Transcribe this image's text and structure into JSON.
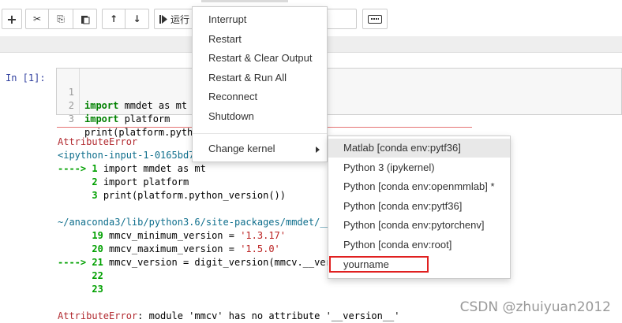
{
  "toolbar": {
    "buttons": [
      {
        "name": "add-cell",
        "glyph": "+"
      },
      {
        "name": "cut",
        "glyph": "✂"
      },
      {
        "name": "copy",
        "glyph": "⎘"
      },
      {
        "name": "paste",
        "glyph": "📋"
      },
      {
        "name": "move-up",
        "glyph": "↑"
      },
      {
        "name": "move-down",
        "glyph": "↓"
      }
    ],
    "run_label": "运行",
    "run_icon": "step-forward-icon",
    "keyboard_icon": "keyboard-icon"
  },
  "cell": {
    "prompt": "In  [1]:",
    "lines": [
      {
        "num": "1",
        "kw": "import",
        "rest": " mmdet as mt"
      },
      {
        "num": "2",
        "kw": "import",
        "rest": " platform"
      },
      {
        "num": "3",
        "kw": "",
        "rest": "print(platform.pytho"
      }
    ]
  },
  "output": {
    "error_name": "AttributeError",
    "input_ref": "<ipython-input-1-0165bd7",
    "trace1": [
      {
        "arrow": "---->",
        "num": "1",
        "code": " import mmdet as mt"
      },
      {
        "arrow": "     ",
        "num": "2",
        "code": " import platform"
      },
      {
        "arrow": "     ",
        "num": "3",
        "code": " print(platform.python_version())"
      }
    ],
    "path": "~/anaconda3/lib/python3.6/site-packages/mmdet/__i",
    "trace2": [
      {
        "arrow": "     ",
        "num": "19",
        "code": " mmcv_minimum_version = ",
        "str": "'1.3.17'"
      },
      {
        "arrow": "     ",
        "num": "20",
        "code": " mmcv_maximum_version = ",
        "str": "'1.5.0'"
      },
      {
        "arrow": "---->",
        "num": "21",
        "code": " mmcv_version = digit_version(mmcv.__versi",
        "str": ""
      },
      {
        "arrow": "     ",
        "num": "22",
        "code": "",
        "str": ""
      },
      {
        "arrow": "     ",
        "num": "23",
        "code": "",
        "str": ""
      }
    ],
    "final_error": "AttributeError",
    "final_msg": ": module 'mmcv' has no attribute '__version__'"
  },
  "kernel_menu": {
    "items": [
      "Interrupt",
      "Restart",
      "Restart & Clear Output",
      "Restart & Run All",
      "Reconnect",
      "Shutdown"
    ],
    "change_kernel": "Change kernel"
  },
  "kernel_submenu": {
    "items": [
      "Matlab [conda env:pytf36]",
      "Python 3 (ipykernel)",
      "Python [conda env:openmmlab] *",
      "Python [conda env:pytf36]",
      "Python [conda env:pytorchenv]",
      "Python [conda env:root]",
      "yourname"
    ],
    "active_index": 0,
    "highlighted_index": 6
  },
  "colors": {
    "highlight_box": "#e02020",
    "error_red": "#b22b31"
  },
  "watermark": "CSDN @zhuiyuan2012"
}
